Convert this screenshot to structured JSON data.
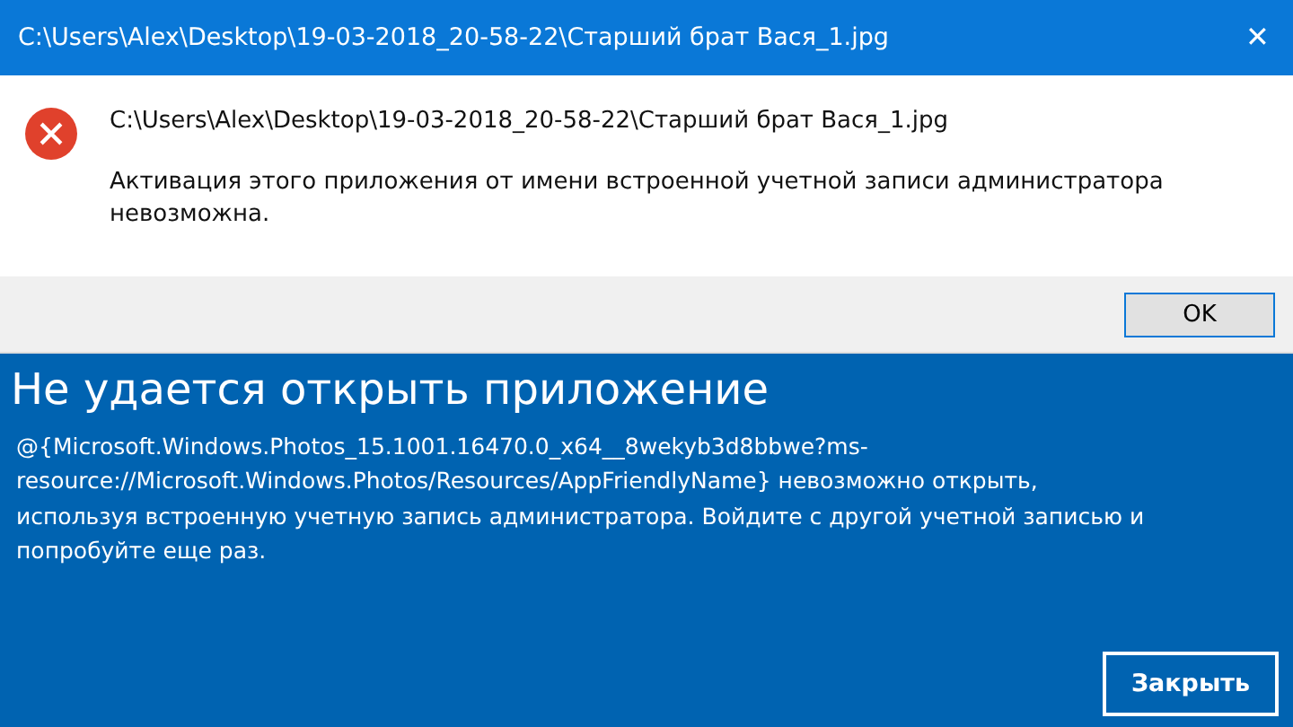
{
  "dialog": {
    "title": "C:\\Users\\Alex\\Desktop\\19-03-2018_20-58-22\\Старший брат Вася_1.jpg",
    "close": "✕",
    "path": "C:\\Users\\Alex\\Desktop\\19-03-2018_20-58-22\\Старший брат Вася_1.jpg",
    "message": "Активация этого приложения от имени встроенной учетной записи администратора невозможна.",
    "button": "OK"
  },
  "app_error": {
    "heading": "Не удается открыть приложение",
    "message": "@{Microsoft.Windows.Photos_15.1001.16470.0_x64__8wekyb3d8bbwe?ms-resource://Microsoft.Windows.Photos/Resources/AppFriendlyName} невозможно открыть, используя встроенную учетную запись администратора. Войдите с другой учетной записью и попробуйте еще раз.",
    "button": "Закрыть"
  }
}
